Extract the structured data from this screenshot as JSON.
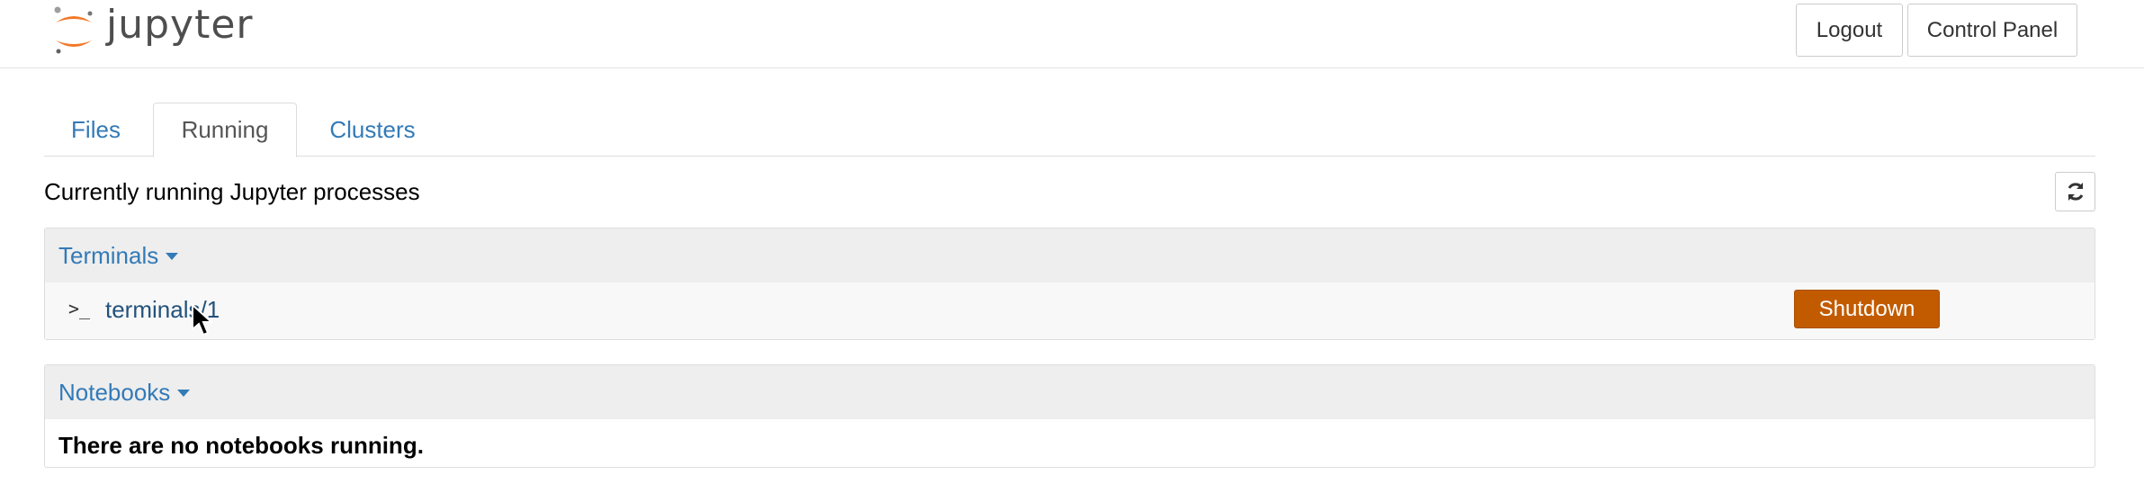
{
  "header": {
    "logo_text": "jupyter",
    "logo_icon": "jupyter-logo-icon",
    "logout_label": "Logout",
    "control_panel_label": "Control Panel"
  },
  "tabs": [
    {
      "label": "Files",
      "active": false
    },
    {
      "label": "Running",
      "active": true
    },
    {
      "label": "Clusters",
      "active": false
    }
  ],
  "running": {
    "title": "Currently running Jupyter processes",
    "refresh_icon": "refresh-icon"
  },
  "terminals": {
    "heading": "Terminals",
    "items": [
      {
        "icon": "terminal-icon",
        "name": "terminals/1",
        "shutdown_label": "Shutdown"
      }
    ]
  },
  "notebooks": {
    "heading": "Notebooks",
    "empty_message": "There are no notebooks running."
  },
  "colors": {
    "link": "#337ab7",
    "shutdown": "#c25b00",
    "logo_orange": "#f37726",
    "logo_gray": "#4e4e4e"
  }
}
